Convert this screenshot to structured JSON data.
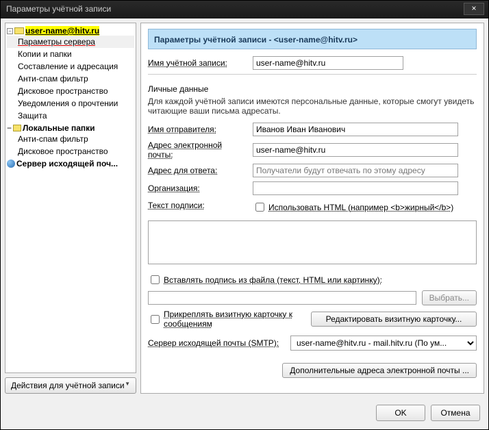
{
  "window": {
    "title": "Параметры учётной записи"
  },
  "sidebar": {
    "account": "user-name@hitv.ru",
    "items": [
      "Параметры сервера",
      "Копии и папки",
      "Составление и адресация",
      "Анти-спам фильтр",
      "Дисковое пространство",
      "Уведомления о прочтении",
      "Защита"
    ],
    "local_root": "Локальные папки",
    "local_items": [
      "Анти-спам фильтр",
      "Дисковое пространство"
    ],
    "smtp_server": "Сервер исходящей поч...",
    "actions_btn": "Действия для учётной записи"
  },
  "content": {
    "header_prefix": "Параметры учётной записи - ",
    "header_email": "<user-name@hitv.ru>",
    "account_name_label": "Имя учётной записи:",
    "account_name_value": "user-name@hitv.ru",
    "personal_title": "Личные данные",
    "personal_desc": "Для каждой учётной записи имеются персональные данные, которые смогут увидеть читающие ваши письма адресаты.",
    "sender_name_label": "Имя отправителя:",
    "sender_name_value": "Иванов Иван Иванович",
    "email_label": "Адрес электронной почты:",
    "email_value": "user-name@hitv.ru",
    "reply_label": "Адрес для ответа:",
    "reply_placeholder": "Получатели будут отвечать по этому адресу",
    "org_label": "Организация:",
    "sig_label": "Текст подписи:",
    "use_html_label": "Использовать HTML (например <b>жирный</b>)",
    "sig_file_label": "Вставлять подпись из файла (текст, HTML или картинку):",
    "browse_btn": "Выбрать...",
    "vcard_label": "Прикреплять визитную карточку к сообщениям",
    "edit_vcard_btn": "Редактировать визитную карточку...",
    "smtp_label": "Сервер исходящей почты (SMTP):",
    "smtp_value": "user-name@hitv.ru - mail.hitv.ru       (По ум...",
    "additional_btn": "Дополнительные адреса электронной почты ..."
  },
  "footer": {
    "ok": "OK",
    "cancel": "Отмена"
  }
}
